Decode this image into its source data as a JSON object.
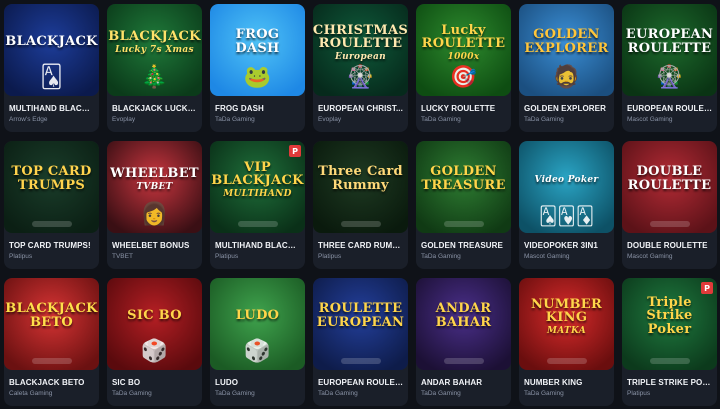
{
  "games": [
    {
      "name": "MULTIHAND BLACK...",
      "provider": "Arrow's Edge",
      "art": "BLACKJACK",
      "art_sub": "",
      "bg": "#1d3d9a",
      "bg2": "#0b1a4d",
      "tint": "#ffffff",
      "icon": "cards-icon",
      "glyph": "🂡",
      "badge": ""
    },
    {
      "name": "BLACKJACK LUCKY...",
      "provider": "Evoplay",
      "art": "BLACKJACK",
      "art_sub": "Lucky 7s Xmas",
      "bg": "#1f7a3a",
      "bg2": "#0b3b1a",
      "tint": "#ffe26a",
      "icon": "christmas-tree-icon",
      "glyph": "🎄",
      "badge": ""
    },
    {
      "name": "FROG DASH",
      "provider": "TaDa Gaming",
      "art": "FROG DASH",
      "art_sub": "",
      "bg": "#4fc3f7",
      "bg2": "#1e88e5",
      "tint": "#ffffff",
      "icon": "frog-icon",
      "glyph": "🐸",
      "badge": ""
    },
    {
      "name": "EUROPEAN CHRIST...",
      "provider": "Evoplay",
      "art": "CHRISTMAS ROULETTE",
      "art_sub": "European",
      "bg": "#0f5a3a",
      "bg2": "#062a1c",
      "tint": "#ffe9b0",
      "icon": "roulette-icon",
      "glyph": "🎡",
      "badge": ""
    },
    {
      "name": "LUCKY ROULETTE",
      "provider": "TaDa Gaming",
      "art": "Lucky ROULETTE",
      "art_sub": "1000x",
      "bg": "#2e8b2e",
      "bg2": "#0e4d12",
      "tint": "#ffd54a",
      "icon": "roulette-icon",
      "glyph": "🎯",
      "badge": ""
    },
    {
      "name": "GOLDEN EXPLORER",
      "provider": "TaDa Gaming",
      "art": "GOLDEN EXPLORER",
      "art_sub": "",
      "bg": "#3b8fd6",
      "bg2": "#1b4f80",
      "tint": "#ffc53a",
      "icon": "explorer-icon",
      "glyph": "🧔",
      "badge": ""
    },
    {
      "name": "EUROPEAN ROULET...",
      "provider": "Mascot Gaming",
      "art": "EUROPEAN ROULETTE",
      "art_sub": "",
      "bg": "#1d6a2c",
      "bg2": "#0a3414",
      "tint": "#ffffff",
      "icon": "roulette-icon",
      "glyph": "🎡",
      "badge": ""
    },
    {
      "name": "TOP CARD TRUMPS!",
      "provider": "Platipus",
      "art": "TOP CARD TRUMPS",
      "art_sub": "",
      "bg": "#1a3d2a",
      "bg2": "#0b1f14",
      "tint": "#ffd34d",
      "icon": "trophy-icon",
      "glyph": "",
      "badge": ""
    },
    {
      "name": "WHEELBET BONUS",
      "provider": "TVBET",
      "art": "WHEELBET",
      "art_sub": "TVBET",
      "bg": "#c9363f",
      "bg2": "#3a0f14",
      "tint": "#ffffff",
      "icon": "presenter-icon",
      "glyph": "👩",
      "badge": ""
    },
    {
      "name": "MULTIHAND BLACK...",
      "provider": "Platipus",
      "art": "VIP BLACKJACK",
      "art_sub": "MULTIHAND",
      "bg": "#1f6f3a",
      "bg2": "#0a3018",
      "tint": "#ffd54a",
      "icon": "cards-icon",
      "glyph": "",
      "badge": "P"
    },
    {
      "name": "THREE CARD RUMMY",
      "provider": "Platipus",
      "art": "Three Card Rummy",
      "art_sub": "",
      "bg": "#1e3a22",
      "bg2": "#0a1a0d",
      "tint": "#ffd979",
      "icon": "cards-icon",
      "glyph": "",
      "badge": ""
    },
    {
      "name": "GOLDEN TREASURE",
      "provider": "TaDa Gaming",
      "art": "GOLDEN TREASURE",
      "art_sub": "",
      "bg": "#2e7d32",
      "bg2": "#103a14",
      "tint": "#ffd54a",
      "icon": "wheel-icon",
      "glyph": "",
      "badge": ""
    },
    {
      "name": "VIDEOPOKER 3IN1",
      "provider": "Mascot Gaming",
      "art": "",
      "art_sub": "Video Poker",
      "bg": "#2aa4c4",
      "bg2": "#0d5166",
      "tint": "#ffffff",
      "icon": "cards-icon",
      "glyph": "🂡🂱🃁",
      "badge": ""
    },
    {
      "name": "DOUBLE ROULETTE",
      "provider": "Mascot Gaming",
      "art": "DOUBLE ROULETTE",
      "art_sub": "",
      "bg": "#b32b35",
      "bg2": "#5c1218",
      "tint": "#ffffff",
      "icon": "roulette-icon",
      "glyph": "",
      "badge": ""
    },
    {
      "name": "BLACKJACK BETO",
      "provider": "Caleta Gaming",
      "art": "BLACKJACK BETO",
      "art_sub": "",
      "bg": "#d73434",
      "bg2": "#6b1111",
      "tint": "#ffe04a",
      "icon": "mascot-icon",
      "glyph": "",
      "badge": ""
    },
    {
      "name": "SIC BO",
      "provider": "TaDa Gaming",
      "art": "SIC BO",
      "art_sub": "",
      "bg": "#b51f24",
      "bg2": "#5a0a0d",
      "tint": "#ffd54a",
      "icon": "dice-icon",
      "glyph": "🎲",
      "badge": ""
    },
    {
      "name": "LUDO",
      "provider": "TaDa Gaming",
      "art": "LUDO",
      "art_sub": "",
      "bg": "#3fa34d",
      "bg2": "#1b5b24",
      "tint": "#ffd54a",
      "icon": "dice-icon",
      "glyph": "🎲",
      "badge": ""
    },
    {
      "name": "EUROPEAN ROULET...",
      "provider": "TaDa Gaming",
      "art": "ROULETTE EUROPEAN",
      "art_sub": "",
      "bg": "#233f9b",
      "bg2": "#0e1c4a",
      "tint": "#ffd54a",
      "icon": "roulette-icon",
      "glyph": "",
      "badge": ""
    },
    {
      "name": "ANDAR BAHAR",
      "provider": "TaDa Gaming",
      "art": "ANDAR BAHAR",
      "art_sub": "",
      "bg": "#4a2f8a",
      "bg2": "#1c1035",
      "tint": "#ffd54a",
      "icon": "dealer-icon",
      "glyph": "",
      "badge": ""
    },
    {
      "name": "NUMBER KING",
      "provider": "TaDa Gaming",
      "art": "NUMBER KING",
      "art_sub": "MATKA",
      "bg": "#d82b2b",
      "bg2": "#6a0e0e",
      "tint": "#ffd54a",
      "icon": "wheel-icon",
      "glyph": "",
      "badge": ""
    },
    {
      "name": "TRIPLE STRIKE POK...",
      "provider": "Platipus",
      "art": "Triple Strike Poker",
      "art_sub": "",
      "bg": "#1f7a3f",
      "bg2": "#0c3a1c",
      "tint": "#ffd54a",
      "icon": "cards-icon",
      "glyph": "",
      "badge": "P"
    }
  ]
}
